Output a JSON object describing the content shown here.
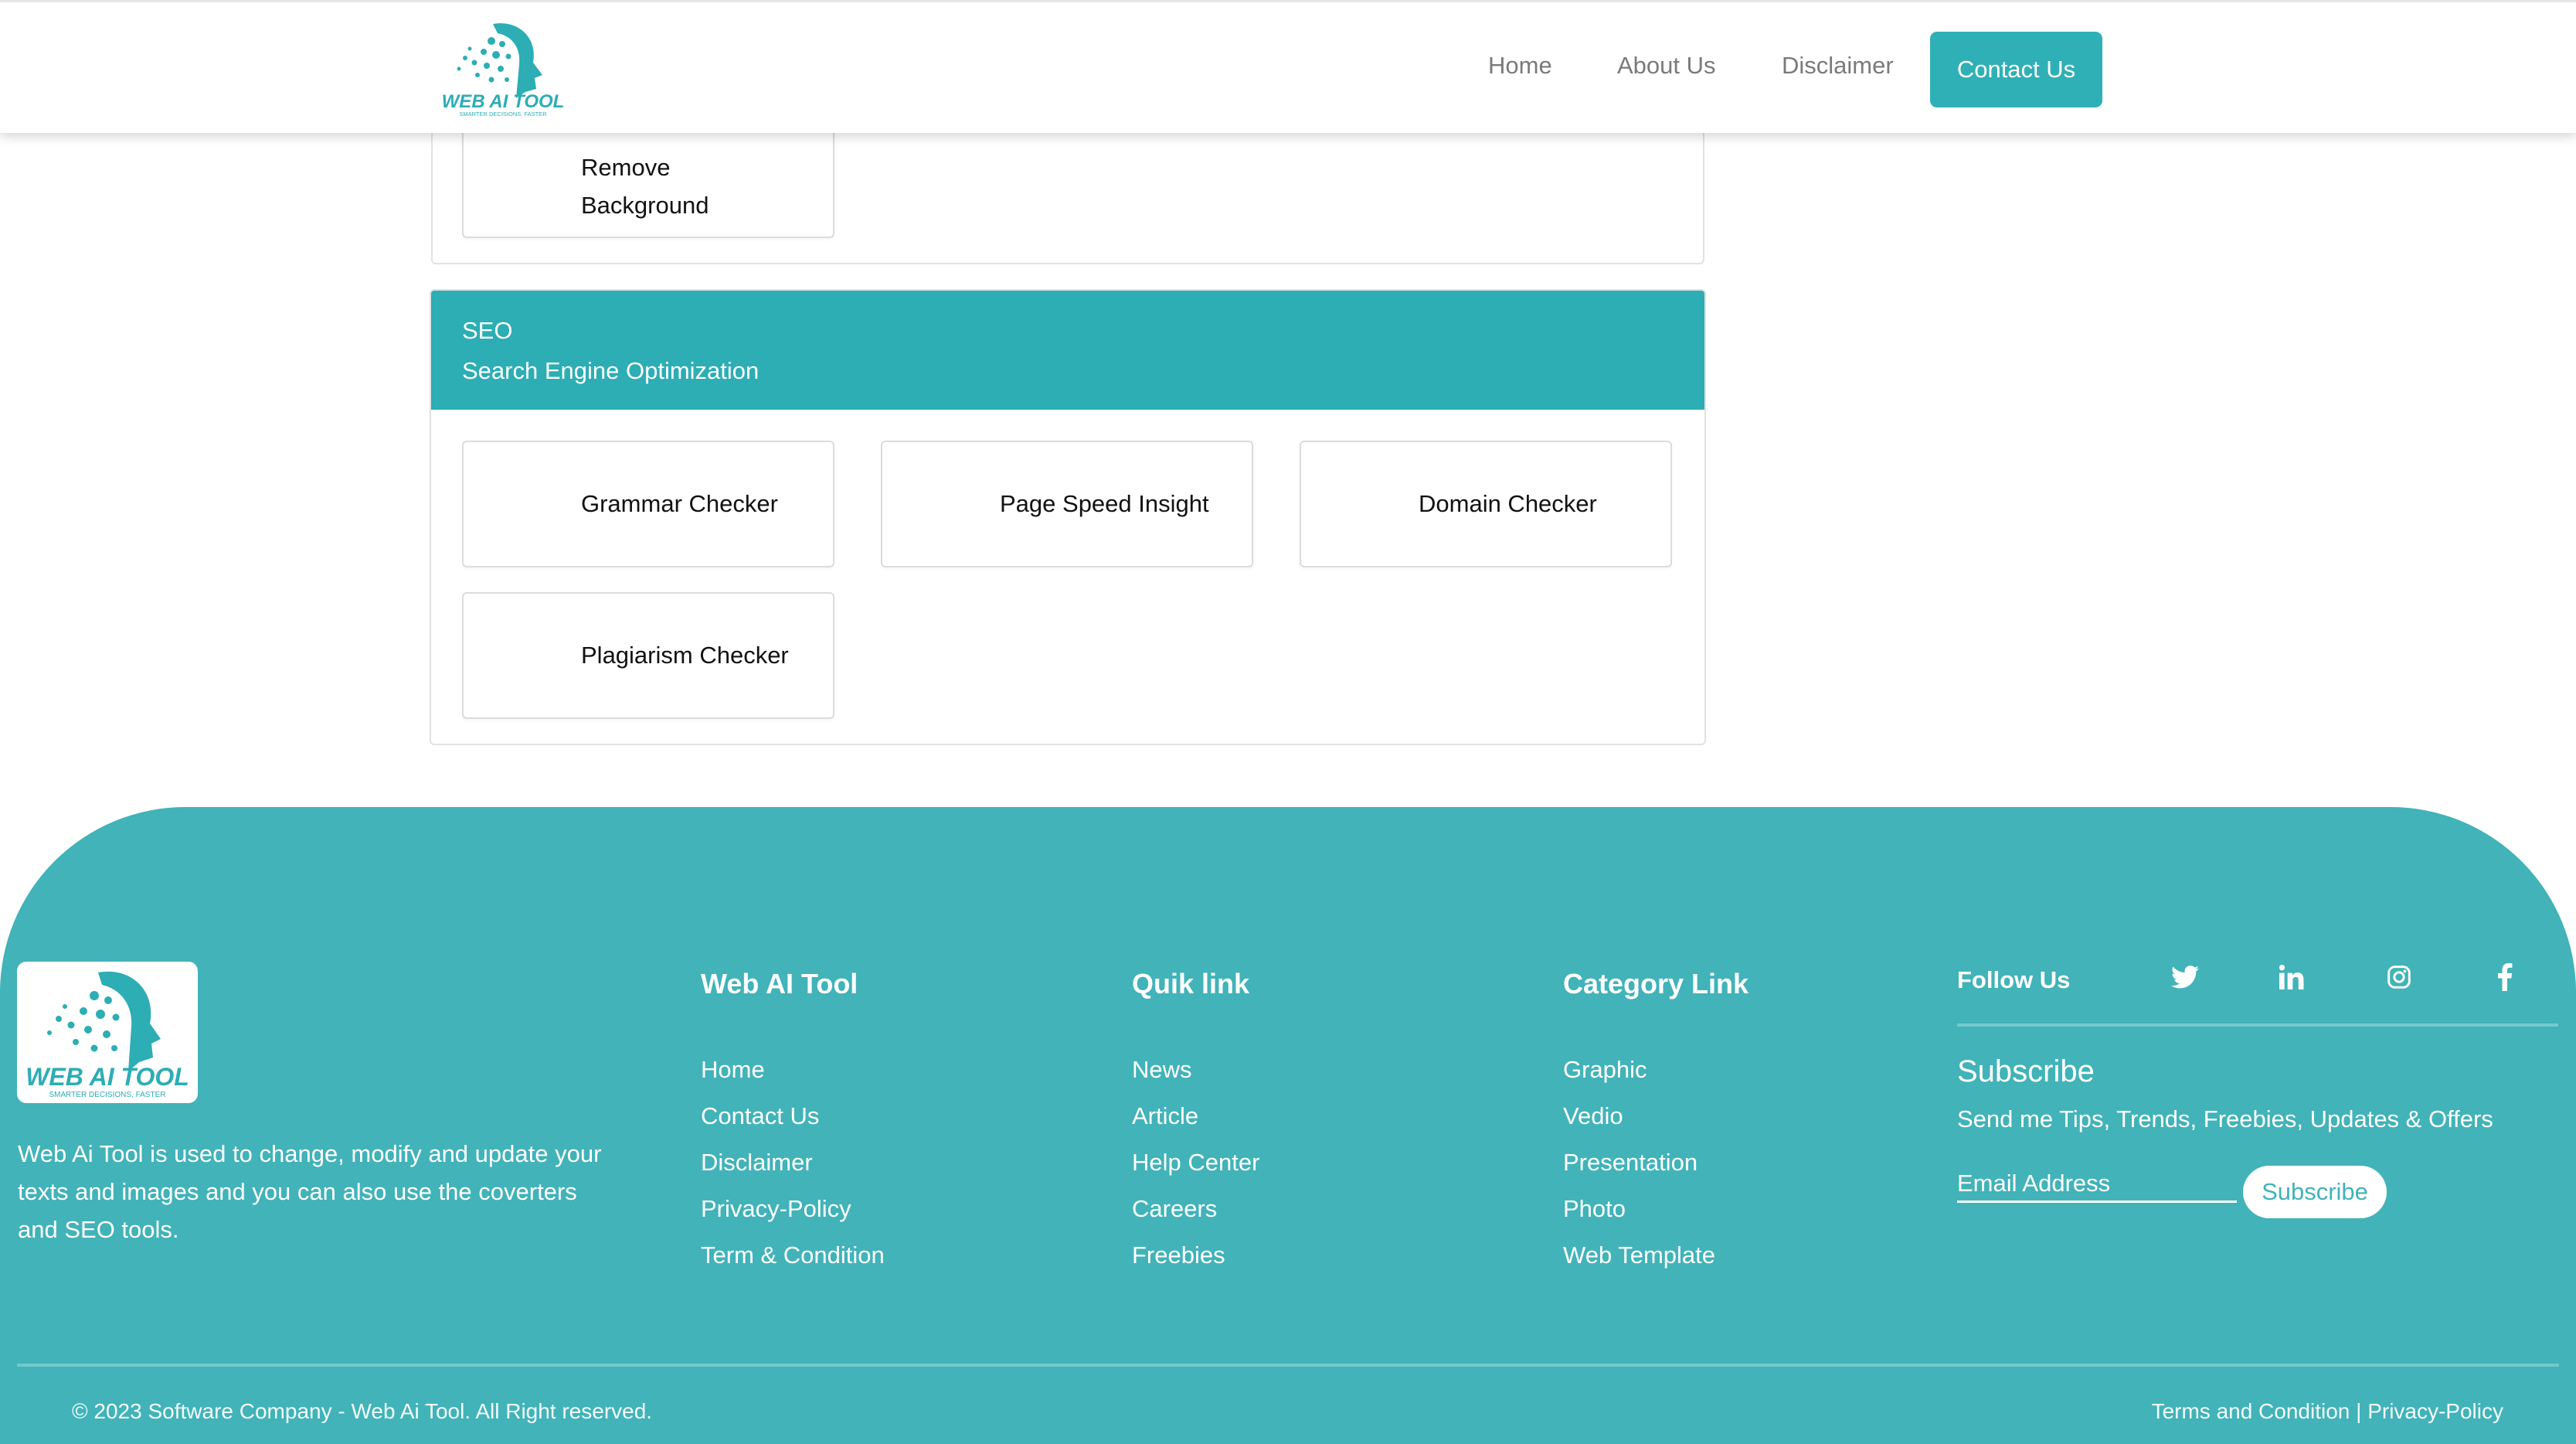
{
  "header": {
    "logo_text": "WEB AI TOOL",
    "logo_tagline": "SMARTER DECISIONS, FASTER",
    "nav": {
      "home": "Home",
      "about": "About Us",
      "disclaimer": "Disclaimer",
      "contact": "Contact Us"
    }
  },
  "image_section": {
    "tools": [
      "Remove",
      "Background"
    ]
  },
  "seo_section": {
    "title": "SEO",
    "subtitle": "Search Engine Optimization",
    "tools": [
      "Grammar Checker",
      "Page Speed Insight",
      "Domain Checker",
      "Plagiarism Checker"
    ]
  },
  "footer": {
    "logo_text": "WEB AI TOOL",
    "logo_tagline": "SMARTER DECISIONS, FASTER",
    "description": "Web Ai Tool is used to change, modify and update your texts and images and you can also use the coverters and SEO tools.",
    "columns": [
      {
        "title": "Web AI Tool",
        "links": [
          "Home",
          "Contact Us",
          "Disclaimer",
          "Privacy-Policy",
          "Term & Condition"
        ]
      },
      {
        "title": "Quik link",
        "links": [
          "News",
          "Article",
          "Help Center",
          "Careers",
          "Freebies"
        ]
      },
      {
        "title": "Category Link",
        "links": [
          "Graphic",
          "Vedio",
          "Presentation",
          "Photo",
          "Web Template"
        ]
      }
    ],
    "follow_label": "Follow Us",
    "social_icons": [
      "twitter-icon",
      "linkedin-icon",
      "instagram-icon",
      "facebook-icon"
    ],
    "subscribe": {
      "title": "Subscribe",
      "description": "Send me Tips, Trends, Freebies, Updates & Offers",
      "email_placeholder": "Email Address",
      "button": "Subscribe"
    },
    "copyright": "© 2023 Software Company - Web Ai Tool. All Right reserved.",
    "legal": "Terms and Condition | Privacy-Policy"
  },
  "colors": {
    "accent": "#2dadb4",
    "footer_bg": "#41b3b9",
    "nav_text": "#7a7a7a"
  }
}
